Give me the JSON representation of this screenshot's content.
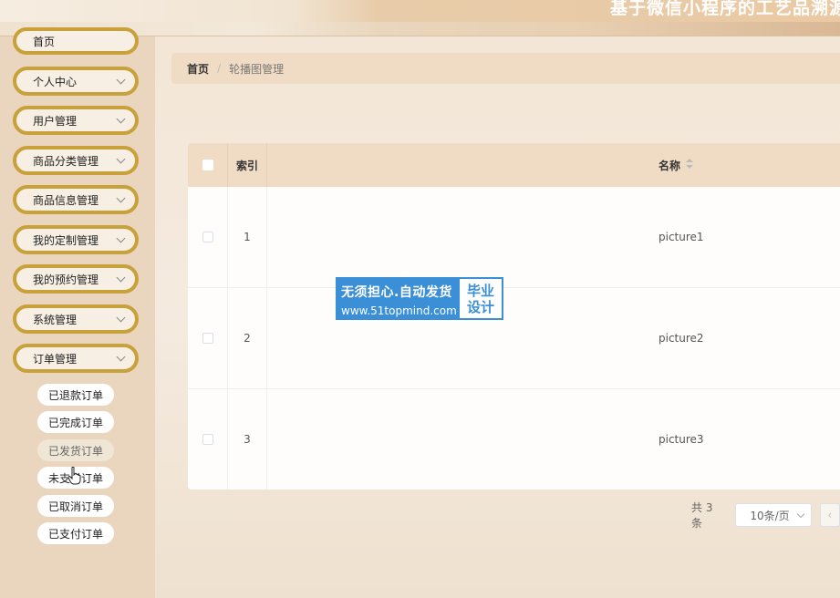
{
  "app": {
    "title": "基于微信小程序的工艺品溯源"
  },
  "sidebar": {
    "home": "首页",
    "items": [
      {
        "label": "个人中心"
      },
      {
        "label": "用户管理"
      },
      {
        "label": "商品分类管理"
      },
      {
        "label": "商品信息管理"
      },
      {
        "label": "我的定制管理"
      },
      {
        "label": "我的预约管理"
      },
      {
        "label": "系统管理"
      },
      {
        "label": "订单管理"
      }
    ],
    "submenu": [
      {
        "label": "已退款订单"
      },
      {
        "label": "已完成订单"
      },
      {
        "label": "已发货订单"
      },
      {
        "label": "未支付订单"
      },
      {
        "label": "已取消订单"
      },
      {
        "label": "已支付订单"
      }
    ]
  },
  "breadcrumb": {
    "home": "首页",
    "separator": "/",
    "current": "轮播图管理"
  },
  "table": {
    "columns": {
      "index": "索引",
      "name": "名称"
    },
    "rows": [
      {
        "index": "1",
        "name": "picture1"
      },
      {
        "index": "2",
        "name": "picture2"
      },
      {
        "index": "3",
        "name": "picture3"
      }
    ]
  },
  "pager": {
    "total": "共 3 条",
    "page_size": "10条/页",
    "prev": "‹"
  },
  "watermark": {
    "line1": "无须担心.自动发货",
    "line2": "www.51topmind.com",
    "badge1": "毕业",
    "badge2": "设计"
  },
  "colors": {
    "accent": "#c9a13a",
    "header": "#f0dcc4",
    "watermark": "#3a8fd6"
  }
}
